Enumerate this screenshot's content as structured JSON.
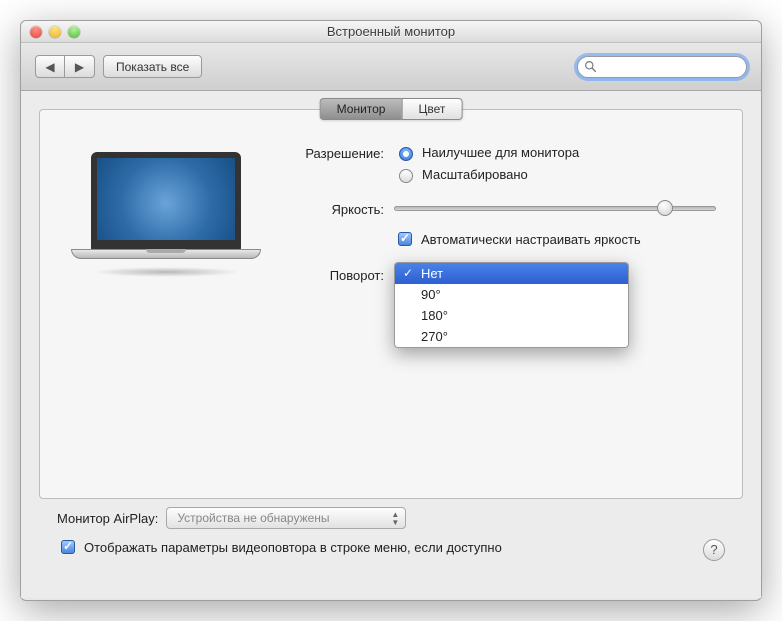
{
  "window": {
    "title": "Встроенный монитор"
  },
  "toolbar": {
    "back_icon": "◀",
    "fwd_icon": "▶",
    "show_all": "Показать все"
  },
  "search": {
    "placeholder": ""
  },
  "tabs": {
    "display": "Монитор",
    "color": "Цвет"
  },
  "resolution": {
    "label": "Разрешение:",
    "best": "Наилучшее для монитора",
    "scaled": "Масштабировано",
    "selected": "best"
  },
  "brightness": {
    "label": "Яркость:",
    "value": 82,
    "auto_label": "Автоматически настраивать яркость",
    "auto_checked": true
  },
  "rotation": {
    "label": "Поворот:",
    "options": [
      "Нет",
      "90°",
      "180°",
      "270°"
    ],
    "selected_index": 0
  },
  "airplay": {
    "label": "Монитор AirPlay:",
    "selected": "Устройства не обнаружены"
  },
  "mirror": {
    "label": "Отображать параметры видеоповтора в строке меню, если доступно",
    "checked": true
  },
  "help_glyph": "?"
}
